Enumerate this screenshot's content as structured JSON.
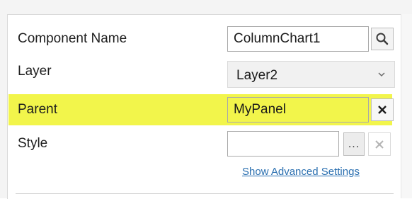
{
  "properties": {
    "component_name": {
      "label": "Component Name",
      "value": "ColumnChart1",
      "button_icon": "search-icon"
    },
    "layer": {
      "label": "Layer",
      "value": "Layer2",
      "dropdown_icon": "chevron-down-icon"
    },
    "parent": {
      "label": "Parent",
      "value": "MyPanel",
      "clear_icon": "close-icon"
    },
    "style": {
      "label": "Style",
      "value": "",
      "browse_label": "...",
      "clear_icon": "close-icon"
    }
  },
  "advanced_link": "Show Advanced Settings",
  "colors": {
    "highlight": "#f2f54b",
    "link": "#2a6fb0"
  }
}
